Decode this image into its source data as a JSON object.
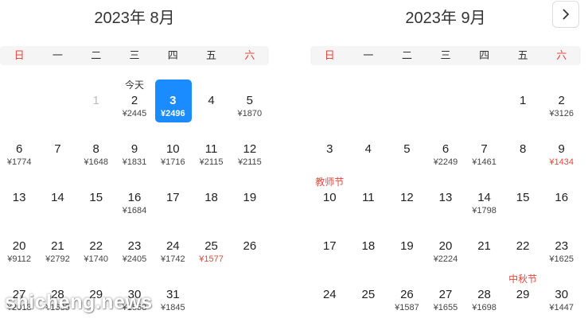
{
  "nav": {
    "next_icon": "chevron-right-icon"
  },
  "colors": {
    "weekend": "#e8473c",
    "selected": "#1a8cff",
    "lowest_price": "#e8473c"
  },
  "weekdays": [
    "日",
    "一",
    "二",
    "三",
    "四",
    "五",
    "六"
  ],
  "months": [
    {
      "title": "2023年 8月",
      "weeks": [
        [
          {
            "day": ""
          },
          {
            "day": ""
          },
          {
            "day": "1",
            "dim": true
          },
          {
            "day": "2",
            "tag": "今天",
            "price": "¥2445"
          },
          {
            "day": "3",
            "price": "¥2496",
            "selected": true
          },
          {
            "day": "4"
          },
          {
            "day": "5",
            "price": "¥1870"
          }
        ],
        [
          {
            "day": "6",
            "price": "¥1774"
          },
          {
            "day": "7"
          },
          {
            "day": "8",
            "price": "¥1648"
          },
          {
            "day": "9",
            "price": "¥1831"
          },
          {
            "day": "10",
            "price": "¥1716"
          },
          {
            "day": "11",
            "price": "¥2115"
          },
          {
            "day": "12",
            "price": "¥2115"
          }
        ],
        [
          {
            "day": "13"
          },
          {
            "day": "14"
          },
          {
            "day": "15"
          },
          {
            "day": "16",
            "price": "¥1684"
          },
          {
            "day": "17"
          },
          {
            "day": "18"
          },
          {
            "day": "19"
          }
        ],
        [
          {
            "day": "20",
            "price": "¥9112"
          },
          {
            "day": "21",
            "price": "¥2792"
          },
          {
            "day": "22",
            "price": "¥1740"
          },
          {
            "day": "23",
            "price": "¥2405"
          },
          {
            "day": "24",
            "price": "¥1742"
          },
          {
            "day": "25",
            "price": "¥1577",
            "price_red": true
          },
          {
            "day": "26"
          }
        ],
        [
          {
            "day": "27",
            "price": "¥2013"
          },
          {
            "day": "28",
            "price": "¥1635"
          },
          {
            "day": "29"
          },
          {
            "day": "30",
            "price": "¥1558"
          },
          {
            "day": "31",
            "price": "¥1845"
          },
          {
            "day": ""
          },
          {
            "day": ""
          }
        ]
      ]
    },
    {
      "title": "2023年 9月",
      "weeks": [
        [
          {
            "day": ""
          },
          {
            "day": ""
          },
          {
            "day": ""
          },
          {
            "day": ""
          },
          {
            "day": ""
          },
          {
            "day": "1"
          },
          {
            "day": "2",
            "price": "¥3126"
          }
        ],
        [
          {
            "day": "3"
          },
          {
            "day": "4"
          },
          {
            "day": "5"
          },
          {
            "day": "6",
            "price": "¥2249"
          },
          {
            "day": "7",
            "price": "¥1461"
          },
          {
            "day": "8"
          },
          {
            "day": "9",
            "price": "¥1434",
            "price_red": true
          }
        ],
        [
          {
            "day": "10",
            "tag": "教师节",
            "tag_red": true
          },
          {
            "day": "11"
          },
          {
            "day": "12"
          },
          {
            "day": "13"
          },
          {
            "day": "14",
            "price": "¥1798"
          },
          {
            "day": "15"
          },
          {
            "day": "16"
          }
        ],
        [
          {
            "day": "17"
          },
          {
            "day": "18"
          },
          {
            "day": "19"
          },
          {
            "day": "20",
            "price": "¥2224"
          },
          {
            "day": "21"
          },
          {
            "day": "22"
          },
          {
            "day": "23",
            "price": "¥1625"
          }
        ],
        [
          {
            "day": "24"
          },
          {
            "day": "25"
          },
          {
            "day": "26",
            "price": "¥1587"
          },
          {
            "day": "27",
            "price": "¥1655"
          },
          {
            "day": "28",
            "price": "¥1698"
          },
          {
            "day": "29",
            "tag": "中秋节",
            "tag_red": true
          },
          {
            "day": "30",
            "price": "¥1447"
          }
        ]
      ]
    }
  ],
  "watermark": "shicheng.news"
}
